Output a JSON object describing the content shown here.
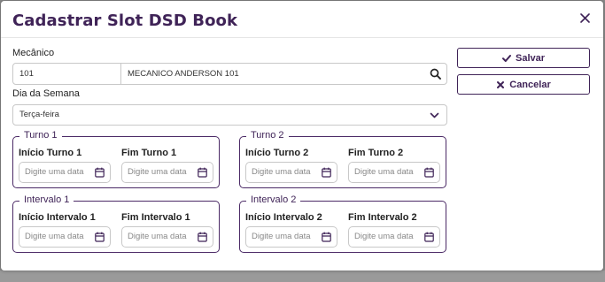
{
  "modal": {
    "title": "Cadastrar Slot DSD Book"
  },
  "mechanic": {
    "label": "Mecânico",
    "code_value": "101",
    "name_value": "MECANICO ANDERSON 101"
  },
  "weekday": {
    "label": "Dia da Semana",
    "selected": "Terça-feira"
  },
  "groups": {
    "turno1": {
      "legend": "Turno 1",
      "start_label": "Início Turno 1",
      "end_label": "Fim Turno 1",
      "start_placeholder": "Digite uma data",
      "end_placeholder": "Digite uma data"
    },
    "turno2": {
      "legend": "Turno 2",
      "start_label": "Início Turno 2",
      "end_label": "Fim Turno 2",
      "start_placeholder": "Digite uma data",
      "end_placeholder": "Digite uma data"
    },
    "intervalo1": {
      "legend": "Intervalo 1",
      "start_label": "Início Intervalo 1",
      "end_label": "Fim Intervalo 1",
      "start_placeholder": "Digite uma data",
      "end_placeholder": "Digite uma data"
    },
    "intervalo2": {
      "legend": "Intervalo 2",
      "start_label": "Início Intervalo 2",
      "end_label": "Fim Intervalo 2",
      "start_placeholder": "Digite uma data",
      "end_placeholder": "Digite uma data"
    }
  },
  "actions": {
    "save_label": "Salvar",
    "cancel_label": "Cancelar"
  },
  "colors": {
    "brand": "#3f2357",
    "border": "#4b2a66"
  },
  "icons": {
    "close": "close-icon",
    "search": "search-icon",
    "dropdown": "chevron-down-icon",
    "calendar": "calendar-icon",
    "save": "check-icon",
    "cancel": "x-icon"
  }
}
